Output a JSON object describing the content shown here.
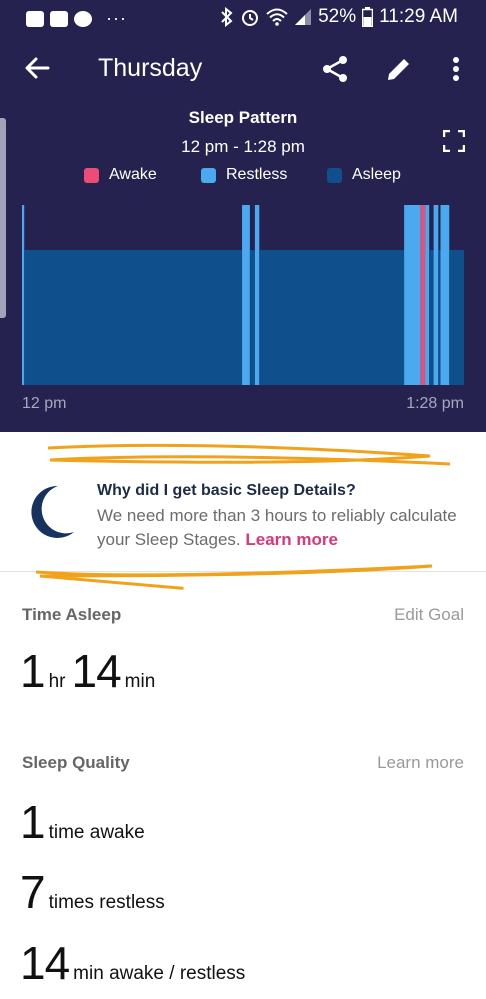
{
  "status_bar": {
    "dots": "···",
    "battery": "52%",
    "time": "11:29 AM"
  },
  "app_bar": {
    "title": "Thursday"
  },
  "chart_header": {
    "title": "Sleep Pattern",
    "subtitle": "12 pm - 1:28 pm"
  },
  "colors": {
    "awake": "#ef4b77",
    "restless": "#4ba9f0",
    "asleep": "#0f4f8c",
    "accent": "#d8377a",
    "header_bg": "#26224f"
  },
  "chart_data": {
    "type": "bar",
    "title": "Sleep Pattern",
    "x_range": [
      "12 pm",
      "1:28 pm"
    ],
    "legend": [
      {
        "name": "Awake",
        "color": "#ef4b77"
      },
      {
        "name": "Restless",
        "color": "#4ba9f0"
      },
      {
        "name": "Asleep",
        "color": "#0f4f8c"
      }
    ],
    "segments": [
      {
        "state": "Restless",
        "start_min": 0.0,
        "end_min": 0.7
      },
      {
        "state": "Asleep",
        "start_min": 0.7,
        "end_min": 70.2
      },
      {
        "state": "Restless",
        "start_min": 70.2,
        "end_min": 72.7
      },
      {
        "state": "Asleep",
        "start_min": 72.7,
        "end_min": 74.3
      },
      {
        "state": "Restless",
        "start_min": 74.3,
        "end_min": 75.7
      },
      {
        "state": "Asleep",
        "start_min": 75.7,
        "end_min": 73.0
      },
      {
        "state": "Asleep",
        "start_min": 75.7,
        "end_min": 121.9
      },
      {
        "state": "Restless",
        "start_min": 121.9,
        "end_min": 127.2
      },
      {
        "state": "Awake",
        "start_min": 127.2,
        "end_min": 128.6
      },
      {
        "state": "Restless",
        "start_min": 128.6,
        "end_min": 129.9
      },
      {
        "state": "Asleep",
        "start_min": 129.9,
        "end_min": 131.3
      },
      {
        "state": "Restless",
        "start_min": 131.3,
        "end_min": 132.8
      },
      {
        "state": "Asleep",
        "start_min": 132.8,
        "end_min": 133.5
      },
      {
        "state": "Restless",
        "start_min": 133.5,
        "end_min": 136.3
      },
      {
        "state": "Asleep",
        "start_min": 136.3,
        "end_min": 141.0
      }
    ],
    "x_ticks": [
      "12 pm",
      "1:28 pm"
    ]
  },
  "info": {
    "title": "Why did I get basic Sleep Details?",
    "body": "We need more than 3 hours to reliably calculate your Sleep Stages. ",
    "link": "Learn more"
  },
  "time_asleep": {
    "label": "Time Asleep",
    "action": "Edit Goal",
    "hours": "1",
    "hours_unit": "hr",
    "minutes": "14",
    "minutes_unit": "min"
  },
  "sleep_quality": {
    "label": "Sleep Quality",
    "action": "Learn more",
    "items": [
      {
        "value": "1",
        "text": "time awake"
      },
      {
        "value": "7",
        "text": "times restless"
      },
      {
        "value": "14",
        "text": "min awake / restless"
      }
    ]
  }
}
